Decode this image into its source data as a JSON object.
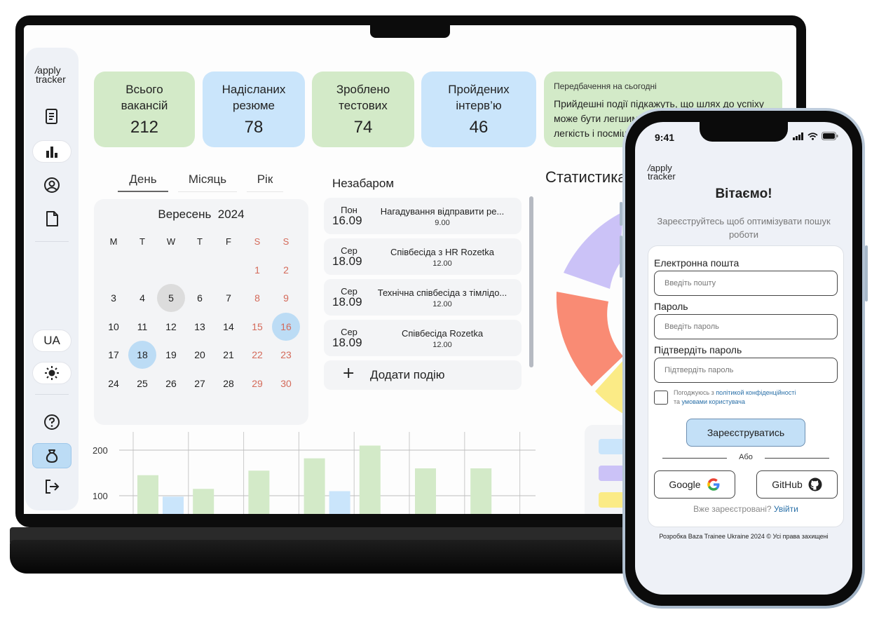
{
  "app": {
    "logo_line1": "apply",
    "logo_line2": "tracker"
  },
  "sidebar": {
    "icons": [
      "document-list-icon",
      "bar-chart-icon",
      "user-circle-icon",
      "file-icon"
    ],
    "language": "UA",
    "theme_icon": "sun-icon",
    "help_icon": "help-circle-icon",
    "money_icon": "money-bag-icon",
    "logout_icon": "logout-icon"
  },
  "stats": [
    {
      "label1": "Всього",
      "label2": "вакансій",
      "value": "212",
      "color": "green"
    },
    {
      "label1": "Надісланих",
      "label2": "резюме",
      "value": "78",
      "color": "blue"
    },
    {
      "label1": "Зроблено",
      "label2": "тестових",
      "value": "74",
      "color": "green"
    },
    {
      "label1": "Пройдених",
      "label2": "інтерв’ю",
      "value": "46",
      "color": "blue"
    }
  ],
  "forecast": {
    "title": "Передбачення на сьогодні",
    "line1": "Прийдешні події підкажуть, що шлях до успіху",
    "line2": "може бути легшим",
    "line3": "легкість і посміш"
  },
  "tabs": [
    {
      "label": "День",
      "active": true
    },
    {
      "label": "Місяць",
      "active": false
    },
    {
      "label": "Рік",
      "active": false
    }
  ],
  "calendar": {
    "month_label": "Вересень",
    "year": "2024",
    "weekdays": [
      "M",
      "T",
      "W",
      "T",
      "F",
      "S",
      "S"
    ],
    "first_weekday": 6,
    "days": 30,
    "today": 5,
    "marked": [
      16,
      18
    ]
  },
  "upcoming": {
    "title": "Незабаром",
    "events": [
      {
        "day": "Пон",
        "date": "16.09",
        "name": "Нагадування відправити ре...",
        "time": "9.00"
      },
      {
        "day": "Сер",
        "date": "18.09",
        "name": "Співбесіда з HR Rozetka",
        "time": "12.00"
      },
      {
        "day": "Сер",
        "date": "18.09",
        "name": "Технічна співбесіда з тімлідо...",
        "time": "12.00"
      },
      {
        "day": "Сер",
        "date": "18.09",
        "name": "Співбесіда  Rozetka",
        "time": "12.00"
      }
    ],
    "add_label": "Додати подію"
  },
  "statistics": {
    "title": "Статистика"
  },
  "chart_data": {
    "type": "bar",
    "y_ticks": [
      "200",
      "100"
    ],
    "ylim": [
      60,
      240
    ],
    "series": [
      {
        "color": "#d3eac8",
        "values": [
          145,
          115,
          155,
          182,
          210,
          160,
          160
        ]
      },
      {
        "color": "#cae5fb",
        "values": [
          98,
          0,
          0,
          110,
          0,
          0,
          0
        ]
      }
    ]
  },
  "phone": {
    "time": "9:41",
    "logo_line1": "apply",
    "logo_line2": "tracker",
    "welcome": "Вітаємо!",
    "subtitle": "Зареєструйтесь щоб оптимізувати пошук роботи",
    "email_label": "Електронна пошта",
    "email_placeholder": "Введіть пошту",
    "password_label": "Пароль",
    "password_placeholder": "Введіть пароль",
    "confirm_label": "Підтвердіть пароль",
    "confirm_placeholder": "Підтвердіть пароль",
    "agree_prefix": "Погоджуюсь з ",
    "agree_link1": "політикой конфіденційності",
    "agree_middle": " та ",
    "agree_link2": "умовами користувача",
    "submit": "Зареєструватись",
    "or": "Або",
    "google": "Google",
    "github": "GitHub",
    "login_prompt": "Вже зареєстровані? ",
    "login_link": "Увійти",
    "footer": "Розробка Baza Trainee Ukraine 2024 ©  Усі права захищені"
  },
  "colors": {
    "green": "#d3eac8",
    "blue": "#cae5fb",
    "donut_purple": "#cbc2f7",
    "donut_orange": "#f98b74",
    "donut_yellow": "#fbeb86",
    "accent_link": "#2a70a8"
  }
}
